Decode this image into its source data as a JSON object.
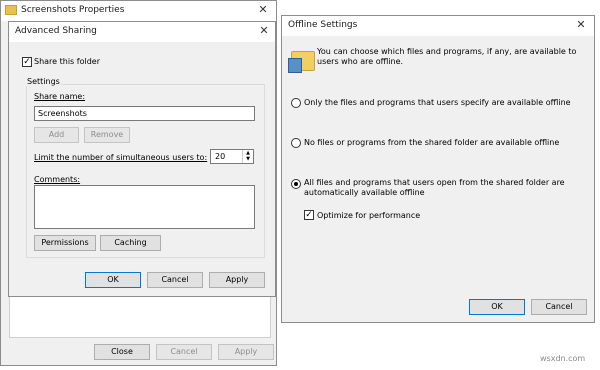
{
  "back_window": {
    "title": "Screenshots Properties",
    "close_glyph": "✕",
    "buttons": {
      "close": "Close",
      "cancel": "Cancel",
      "apply": "Apply"
    }
  },
  "advanced_sharing": {
    "title": "Advanced Sharing",
    "close_glyph": "✕",
    "share_folder": {
      "label": "Share this folder",
      "checked": true
    },
    "settings_group": "Settings",
    "share_name_label": "Share name:",
    "share_name_value": "Screenshots",
    "add_label": "Add",
    "remove_label": "Remove",
    "limit_label": "Limit the number of simultaneous users to:",
    "limit_value": "20",
    "comments_label": "Comments:",
    "comments_value": "",
    "permissions_label": "Permissions",
    "caching_label": "Caching",
    "ok_label": "OK",
    "cancel_label": "Cancel",
    "apply_label": "Apply"
  },
  "offline_settings": {
    "title": "Offline Settings",
    "close_glyph": "✕",
    "description": "You can choose which files and programs, if any, are available to users who are offline.",
    "options": [
      {
        "label": "Only the files and programs that users specify are available offline",
        "selected": false
      },
      {
        "label": "No files or programs from the shared folder are available offline",
        "selected": false
      },
      {
        "label": "All files and programs that users open from the shared folder are automatically available offline",
        "selected": true
      }
    ],
    "optimize": {
      "label": "Optimize for performance",
      "checked": true
    },
    "ok_label": "OK",
    "cancel_label": "Cancel"
  },
  "watermark": "wsxdn.com"
}
